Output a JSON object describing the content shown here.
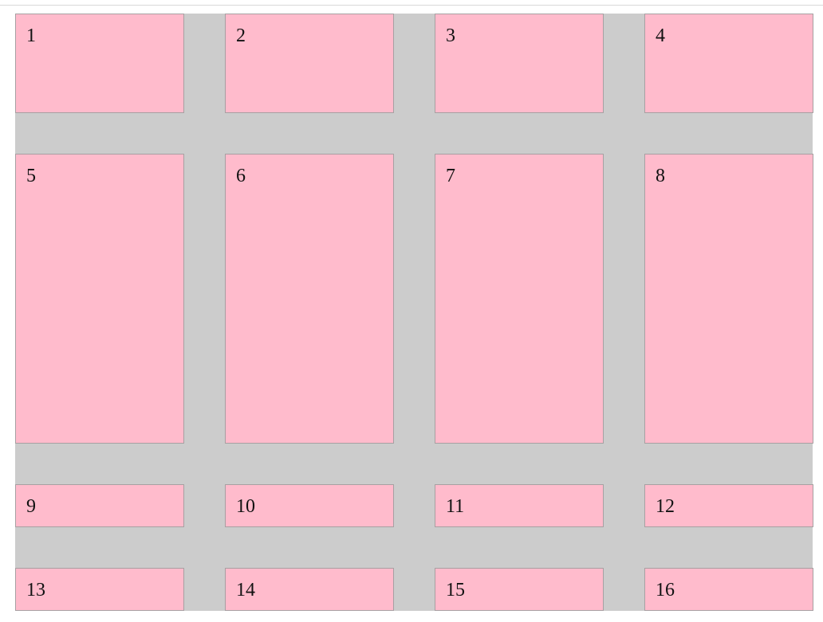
{
  "colors": {
    "page_background": "#ffffff",
    "grid_background": "#cccccc",
    "cell_background": "#ffbbcc",
    "cell_border": "#a7a0a2",
    "text": "#111111"
  },
  "grid": {
    "columns": 4,
    "rows": 4,
    "cells": [
      {
        "label": "1"
      },
      {
        "label": "2"
      },
      {
        "label": "3"
      },
      {
        "label": "4"
      },
      {
        "label": "5"
      },
      {
        "label": "6"
      },
      {
        "label": "7"
      },
      {
        "label": "8"
      },
      {
        "label": "9"
      },
      {
        "label": "10"
      },
      {
        "label": "11"
      },
      {
        "label": "12"
      },
      {
        "label": "13"
      },
      {
        "label": "14"
      },
      {
        "label": "15"
      },
      {
        "label": "16"
      }
    ]
  }
}
